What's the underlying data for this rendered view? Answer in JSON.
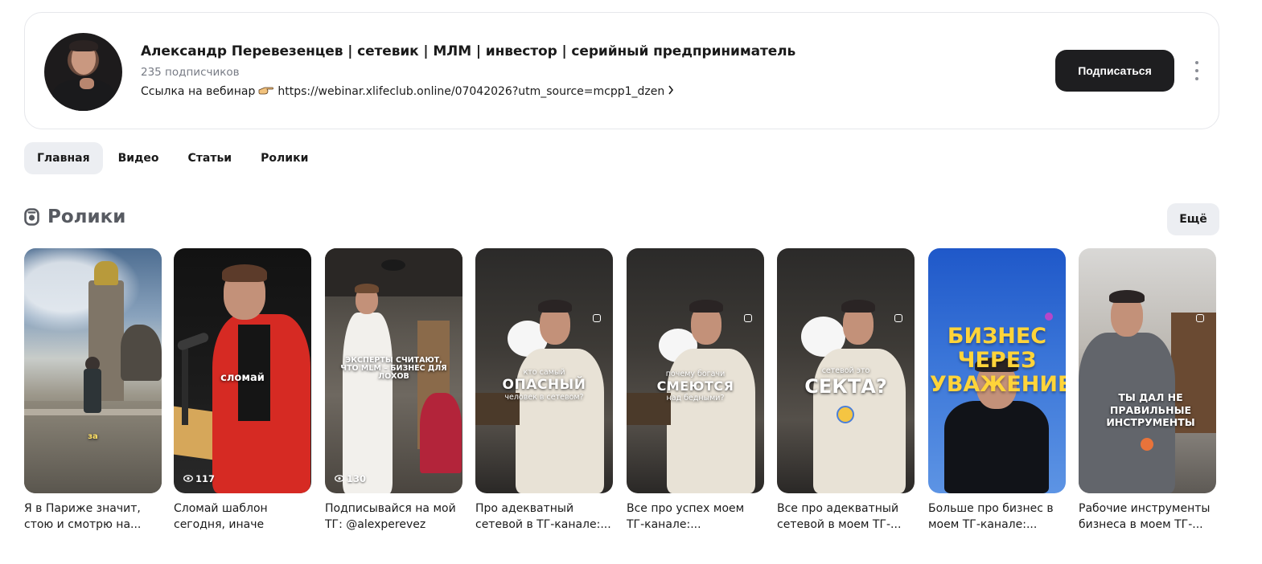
{
  "channel": {
    "title": "Александр Перевезенцев | сетевик | МЛМ | инвестор | серийный предприниматель",
    "subscribers": "235 подписчиков",
    "link_prefix": "Ссылка на вебинар",
    "link_icon": "pointing-hand-icon",
    "link_url": "https://webinar.xlifeclub.online/07042026?utm_source=mcpp1_dzen",
    "subscribe_label": "Подписаться"
  },
  "tabs": [
    {
      "label": "Главная",
      "active": true
    },
    {
      "label": "Видео",
      "active": false
    },
    {
      "label": "Статьи",
      "active": false
    },
    {
      "label": "Ролики",
      "active": false
    }
  ],
  "section": {
    "title": "Ролики",
    "icon": "shorts-icon",
    "more_label": "Ещё"
  },
  "shorts": [
    {
      "caption": "Я в Париже значит, стою и смотрю на...",
      "overlay": "за",
      "views": ""
    },
    {
      "caption": "Сломай шаблон сегодня, иначе завтр...",
      "overlay": "сломай",
      "views": "117"
    },
    {
      "caption": "Подписывайся на мой ТГ: @alexperevez",
      "overlay": "ЭКСПЕРТЫ СЧИТАЮТ, ЧТО MLM – БИЗНЕС ДЛЯ ЛОХОВ",
      "views": "130"
    },
    {
      "caption": "Про адекватный сетевой в ТГ-канале:...",
      "overlay_small": "кто самый",
      "overlay": "ОПАСНЫЙ",
      "overlay_small2": "человек в сетевом?",
      "views": ""
    },
    {
      "caption": "Все про успех моем ТГ-канале:...",
      "overlay_small": "почему богачи",
      "overlay": "СМЕЮТСЯ",
      "overlay_small2": "над бедными?",
      "views": ""
    },
    {
      "caption": "Все про адекватный сетевой в моем ТГ-...",
      "overlay_small": "сетевой это",
      "overlay": "СЕКТА?",
      "views": ""
    },
    {
      "caption": "Больше про бизнес в моем ТГ-канале:...",
      "overlay": "БИЗНЕС ЧЕРЕЗ УВАЖЕНИЕ",
      "views": ""
    },
    {
      "caption": "Рабочие инструменты бизнеса в моем ТГ-...",
      "overlay": "ТЫ ДАЛ НЕ ПРАВИЛЬНЫЕ ИНСТРУМЕНТЫ",
      "views": ""
    }
  ],
  "colors": {
    "accent_dark": "#1e1e20",
    "tab_active_bg": "#eceef2",
    "muted_text": "#777b85"
  }
}
